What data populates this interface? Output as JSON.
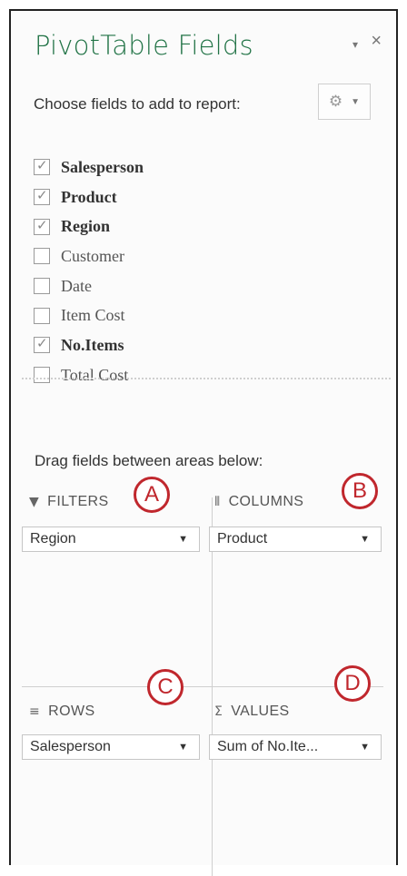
{
  "panel": {
    "title": "PivotTable Fields",
    "choose_label": "Choose fields to add to report:",
    "close_glyph": "×",
    "chevron_glyph": "▾"
  },
  "fields": [
    {
      "label": "Salesperson",
      "checked": true
    },
    {
      "label": "Product",
      "checked": true
    },
    {
      "label": "Region",
      "checked": true
    },
    {
      "label": "Customer",
      "checked": false
    },
    {
      "label": "Date",
      "checked": false
    },
    {
      "label": "Item Cost",
      "checked": false
    },
    {
      "label": "No.Items",
      "checked": true
    },
    {
      "label": "Total Cost",
      "checked": false
    }
  ],
  "drag_label": "Drag fields between areas below:",
  "areas": {
    "filters": {
      "header": "FILTERS",
      "icon": "filter-icon",
      "item": "Region",
      "marker": "A"
    },
    "columns": {
      "header": "COLUMNS",
      "icon": "columns-icon",
      "item": "Product",
      "marker": "B"
    },
    "rows": {
      "header": "ROWS",
      "icon": "rows-icon",
      "item": "Salesperson",
      "marker": "C"
    },
    "values": {
      "header": "VALUES",
      "icon": "sigma-icon",
      "item": "Sum of No.Ite...",
      "marker": "D"
    }
  },
  "colors": {
    "accent": "#217346",
    "marker": "#c0272d"
  }
}
